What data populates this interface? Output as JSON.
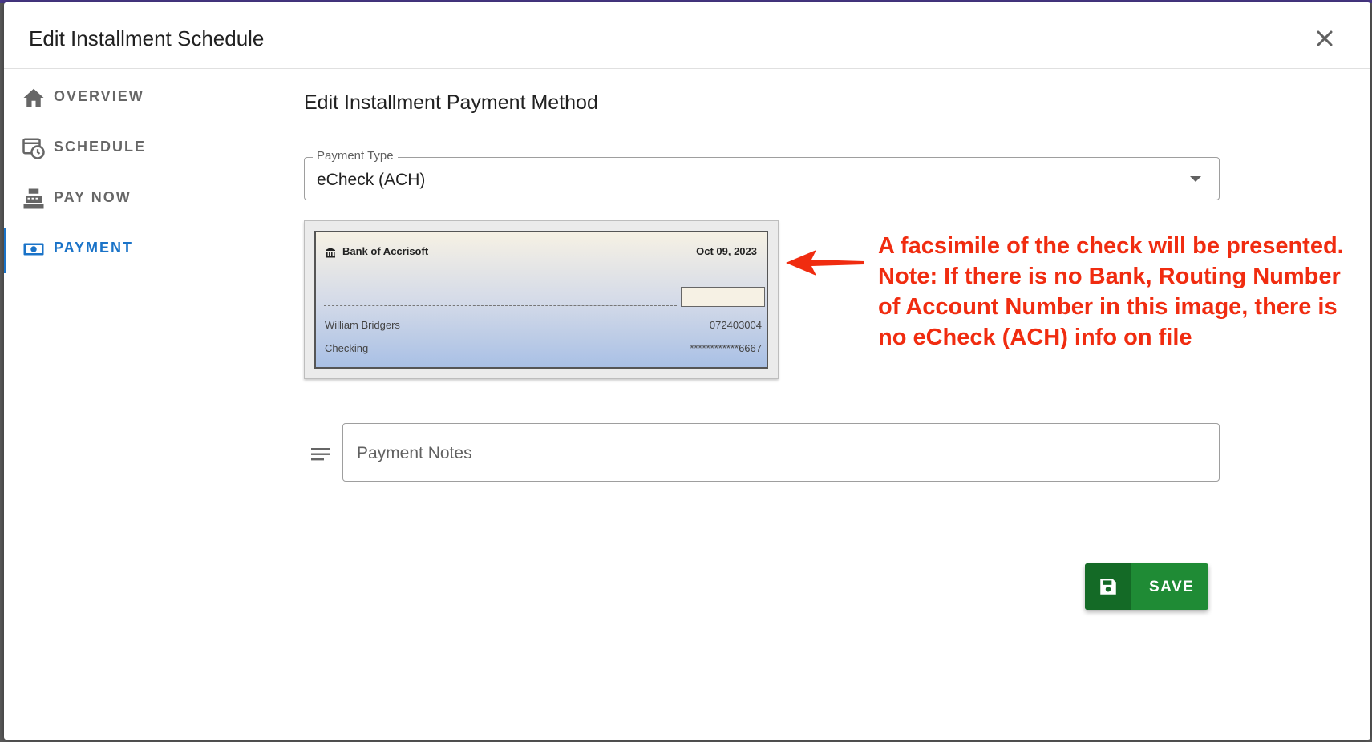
{
  "dialog": {
    "title": "Edit Installment Schedule",
    "close_icon": "close-icon"
  },
  "nav": {
    "items": [
      {
        "label": "OVERVIEW",
        "icon": "home-icon",
        "active": false
      },
      {
        "label": "SCHEDULE",
        "icon": "calendar-clock-icon",
        "active": false
      },
      {
        "label": "PAY NOW",
        "icon": "cash-register-icon",
        "active": false
      },
      {
        "label": "PAYMENT",
        "icon": "money-icon",
        "active": true
      }
    ]
  },
  "main": {
    "section_title": "Edit Installment Payment Method",
    "payment_type": {
      "label": "Payment Type",
      "value": "eCheck (ACH)"
    },
    "check": {
      "bank_name": "Bank of Accrisoft",
      "date": "Oct 09, 2023",
      "holder": "William Bridgers",
      "routing": "072403004",
      "account_type": "Checking",
      "account_number": "************6667"
    },
    "notes": {
      "placeholder": "Payment Notes",
      "value": ""
    },
    "save_label": "SAVE"
  },
  "annotation": {
    "line1": "A facsimile of the check will be presented.",
    "line2": "Note: If there is no Bank, Routing Number of Account Number in this image, there is no eCheck (ACH) info on file"
  },
  "colors": {
    "accent": "#1a73c8",
    "save": "#1f8b35",
    "annotation": "#f02c10"
  }
}
